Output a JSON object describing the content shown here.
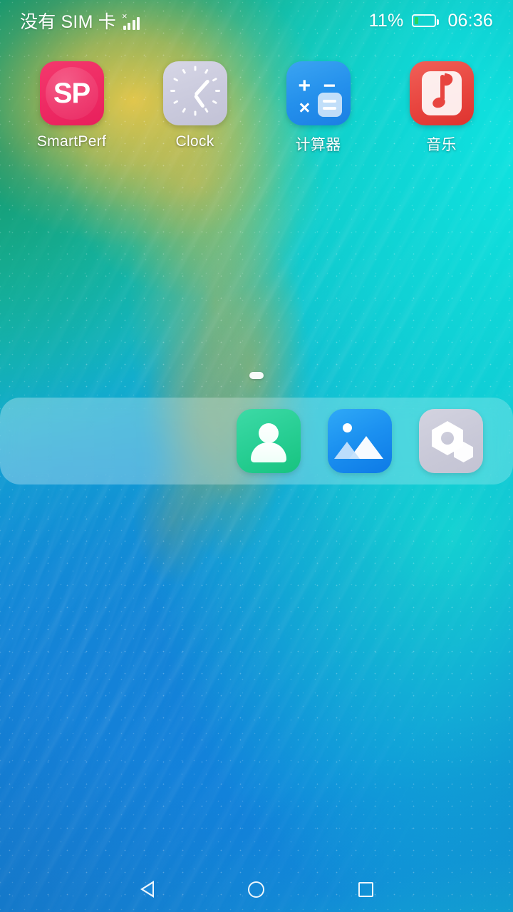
{
  "status_bar": {
    "carrier_text": "没有 SIM 卡",
    "signal_icon": "signal-bars-no-service-icon",
    "battery_percent_text": "11%",
    "battery_level": 11,
    "battery_icon": "battery-icon",
    "time": "06:36"
  },
  "home_screen": {
    "apps": [
      {
        "label": "SmartPerf",
        "icon": "smartperf-icon",
        "icon_text": "SP",
        "color": "#ee2a63"
      },
      {
        "label": "Clock",
        "icon": "clock-icon",
        "color": "#c9c9dc"
      },
      {
        "label": "计算器",
        "icon": "calculator-icon",
        "color": "#2490ec",
        "symbols": {
          "plus": "+",
          "minus": "−",
          "times": "×"
        }
      },
      {
        "label": "音乐",
        "icon": "music-icon",
        "color": "#e8453f"
      }
    ],
    "page_indicator": {
      "total_pages": 1,
      "current_page": 1
    }
  },
  "dock": {
    "apps": [
      {
        "name": "contacts",
        "icon": "contacts-icon",
        "color": "#29cf95"
      },
      {
        "name": "gallery",
        "icon": "gallery-icon",
        "color": "#1b90f0"
      },
      {
        "name": "settings",
        "icon": "settings-icon",
        "color": "#c9c9d8"
      }
    ]
  },
  "nav_bar": {
    "buttons": [
      {
        "name": "back",
        "icon": "back-triangle-icon"
      },
      {
        "name": "home",
        "icon": "home-circle-icon"
      },
      {
        "name": "recents",
        "icon": "recents-square-icon"
      }
    ]
  },
  "theme": {
    "wallpaper_top": "#19a47b",
    "wallpaper_mid": "#12c3be",
    "wallpaper_bottom": "#0f82dd",
    "accent_gold": "#e0c048",
    "label_color": "#ffffff"
  }
}
